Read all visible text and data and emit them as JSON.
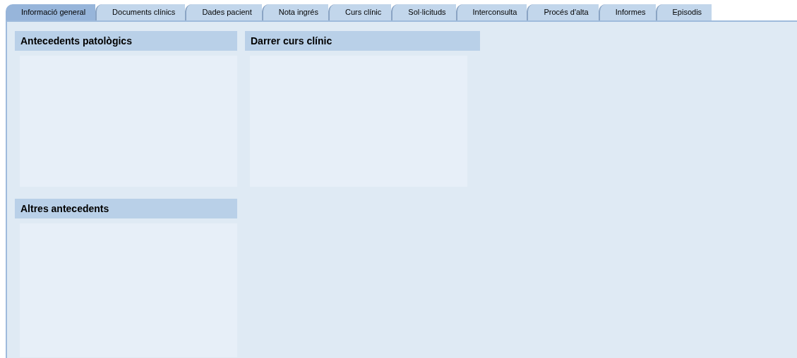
{
  "tabs": [
    {
      "label": "Informació general",
      "selected": true
    },
    {
      "label": "Documents clínics",
      "selected": false
    },
    {
      "label": "Dades pacient",
      "selected": false
    },
    {
      "label": "Nota ingrés",
      "selected": false
    },
    {
      "label": "Curs clínic",
      "selected": false
    },
    {
      "label": "Sol·licituds",
      "selected": false
    },
    {
      "label": "Interconsulta",
      "selected": false
    },
    {
      "label": "Procés d'alta",
      "selected": false
    },
    {
      "label": "Informes",
      "selected": false
    },
    {
      "label": "Episodis",
      "selected": false
    }
  ],
  "panels": [
    {
      "title": "Antecedents patològics"
    },
    {
      "title": "Darrer curs clínic"
    },
    {
      "title": "Altres antecedents"
    }
  ]
}
